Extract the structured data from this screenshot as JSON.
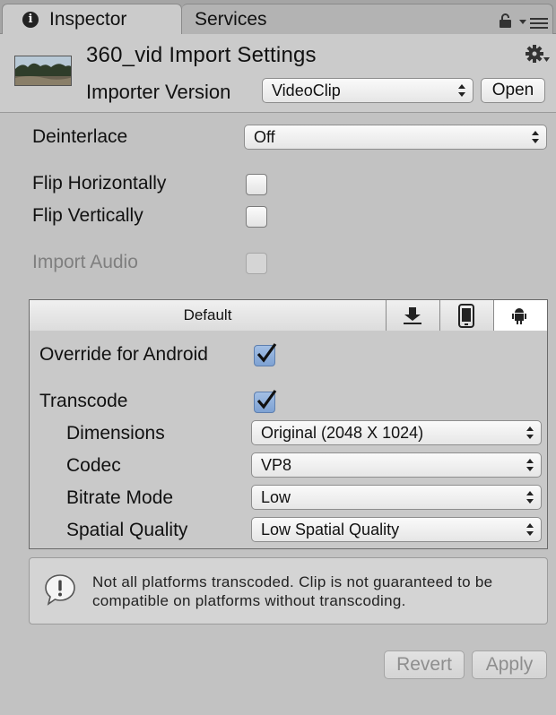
{
  "tabs": {
    "inspector": "Inspector",
    "services": "Services"
  },
  "header": {
    "title": "360_vid Import Settings",
    "importer_label": "Importer Version",
    "importer_value": "VideoClip",
    "open_label": "Open"
  },
  "settings": {
    "deinterlace_label": "Deinterlace",
    "deinterlace_value": "Off",
    "flip_h_label": "Flip Horizontally",
    "flip_h_checked": false,
    "flip_v_label": "Flip Vertically",
    "flip_v_checked": false,
    "import_audio_label": "Import Audio",
    "import_audio_checked": false,
    "import_audio_enabled": false
  },
  "platform": {
    "tabs": [
      {
        "label": "Default",
        "icon": "download-icon"
      },
      {
        "label": "",
        "icon": "download-icon"
      },
      {
        "label": "",
        "icon": "mobile-phone-icon"
      },
      {
        "label": "",
        "icon": "android-icon"
      }
    ],
    "selected_tab": "android",
    "override_label": "Override for Android",
    "override_checked": true,
    "transcode_label": "Transcode",
    "transcode_checked": true,
    "dimensions_label": "Dimensions",
    "dimensions_value": "Original (2048 X 1024)",
    "codec_label": "Codec",
    "codec_value": "VP8",
    "bitrate_label": "Bitrate Mode",
    "bitrate_value": "Low",
    "spatial_label": "Spatial Quality",
    "spatial_value": "Low Spatial Quality"
  },
  "warning": {
    "icon": "warning-speech-icon",
    "text": "Not all platforms transcoded. Clip is not guaranteed to be compatible on platforms without transcoding."
  },
  "footer": {
    "revert_label": "Revert",
    "apply_label": "Apply"
  },
  "colors": {
    "checked_fill": "#7ea2d3",
    "background": "#c2c2c2"
  }
}
